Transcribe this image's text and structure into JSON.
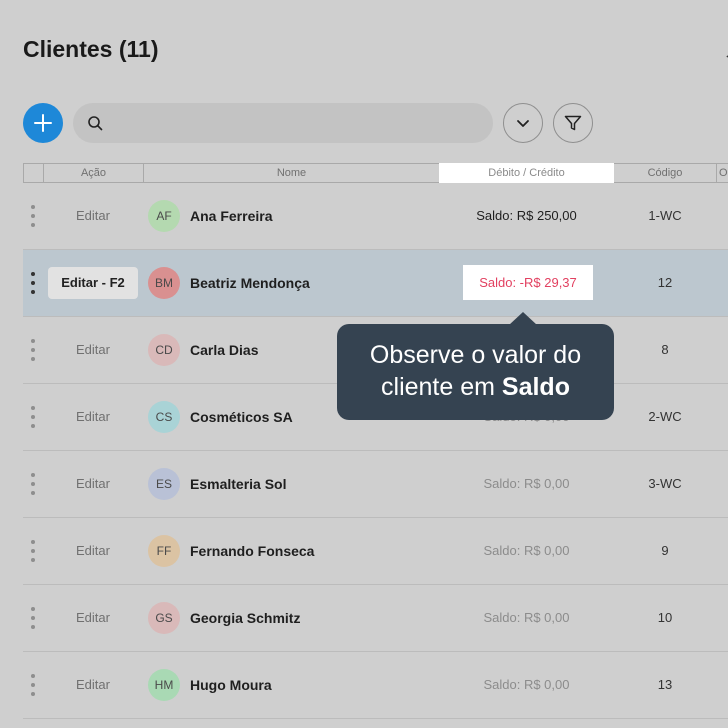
{
  "header": {
    "title": "Clientes (11)",
    "back_glyph": "←"
  },
  "toolbar": {
    "add_icon": "plus-icon",
    "search": {
      "value": "",
      "placeholder": ""
    },
    "expand_icon": "chevron-down-icon",
    "filter_icon": "filter-icon"
  },
  "table": {
    "columns": {
      "acao": "Ação",
      "nome": "Nome",
      "debito": "Débito / Crédito",
      "codigo": "Código",
      "more": "O"
    },
    "rows": [
      {
        "initials": "AF",
        "name": "Ana Ferreira",
        "edit": "Editar",
        "balance": "Saldo: R$ 250,00",
        "code": "1-WC",
        "avatar_color": "#b4d9b0"
      },
      {
        "initials": "BM",
        "name": "Beatriz Mendonça",
        "edit": "Editar - F2",
        "balance": "Saldo: -R$ 29,37",
        "code": "12",
        "avatar_color": "#d99090",
        "selected": true
      },
      {
        "initials": "CD",
        "name": "Carla Dias",
        "edit": "Editar",
        "balance": "",
        "code": "8",
        "avatar_color": "#d9b9b9"
      },
      {
        "initials": "CS",
        "name": "Cosméticos SA",
        "edit": "Editar",
        "balance": "Saldo: R$ 0,00",
        "code": "2-WC",
        "avatar_color": "#a9d3d6"
      },
      {
        "initials": "ES",
        "name": "Esmalteria Sol",
        "edit": "Editar",
        "balance": "Saldo: R$ 0,00",
        "code": "3-WC",
        "avatar_color": "#b9c1d6"
      },
      {
        "initials": "FF",
        "name": "Fernando Fonseca",
        "edit": "Editar",
        "balance": "Saldo: R$ 0,00",
        "code": "9",
        "avatar_color": "#dbc3a3"
      },
      {
        "initials": "GS",
        "name": "Georgia Schmitz",
        "edit": "Editar",
        "balance": "Saldo: R$ 0,00",
        "code": "10",
        "avatar_color": "#d9b9b9"
      },
      {
        "initials": "HM",
        "name": "Hugo Moura",
        "edit": "Editar",
        "balance": "Saldo: R$ 0,00",
        "code": "13",
        "avatar_color": "#a9d9b4"
      }
    ]
  },
  "tooltip": {
    "line1": "Observe o valor do",
    "line2_pre": "cliente em ",
    "line2_bold": "Saldo"
  },
  "colors": {
    "accent": "#1e88d8",
    "negative": "#e24060",
    "tooltip_bg": "#354351",
    "selected_row": "#bcc7cf"
  }
}
